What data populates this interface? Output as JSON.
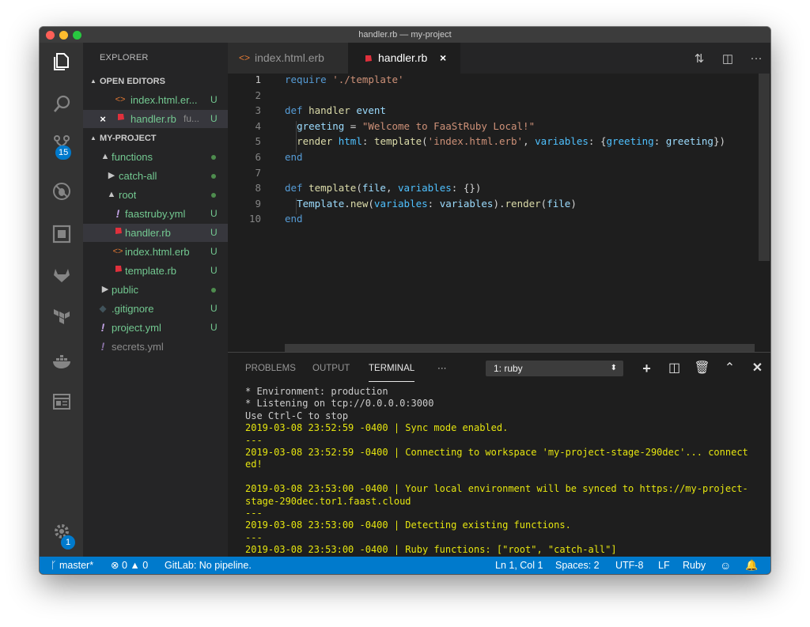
{
  "window": {
    "title": "handler.rb — my-project"
  },
  "activity": {
    "scm_badge": "15",
    "settings_badge": "1"
  },
  "sidebar": {
    "title": "EXPLORER",
    "open_editors_label": "OPEN EDITORS",
    "open_editors": [
      {
        "icon": "<>",
        "name": "index.html.er...",
        "desc": "",
        "status": "U"
      },
      {
        "icon": "×",
        "name": "handler.rb",
        "desc": "fu...",
        "status": "U"
      }
    ],
    "project_label": "MY-PROJECT",
    "tree": [
      {
        "name": "functions",
        "status": ""
      },
      {
        "name": "catch-all",
        "status": ""
      },
      {
        "name": "root",
        "status": ""
      },
      {
        "name": "faastruby.yml",
        "status": "U"
      },
      {
        "name": "handler.rb",
        "status": "U"
      },
      {
        "name": "index.html.erb",
        "status": "U"
      },
      {
        "name": "template.rb",
        "status": "U"
      },
      {
        "name": "public",
        "status": ""
      },
      {
        "name": ".gitignore",
        "status": "U"
      },
      {
        "name": "project.yml",
        "status": "U"
      },
      {
        "name": "secrets.yml",
        "status": ""
      }
    ]
  },
  "tabs": [
    {
      "label": "index.html.erb"
    },
    {
      "label": "handler.rb",
      "close": "×"
    }
  ],
  "editor": {
    "line_numbers": [
      "1",
      "2",
      "3",
      "4",
      "5",
      "6",
      "7",
      "8",
      "9",
      "10"
    ],
    "lines": [
      "require './template'",
      "",
      "def handler event",
      "  greeting = \"Welcome to FaaStRuby Local!\"",
      "  render html: template('index.html.erb', variables: {greeting: greeting})",
      "end",
      "",
      "def template(file, variables: {})",
      "  Template.new(variables: variables).render(file)",
      "end"
    ]
  },
  "panel": {
    "tabs": [
      "PROBLEMS",
      "OUTPUT",
      "TERMINAL"
    ],
    "more": "···",
    "terminal_select": "1: ruby",
    "terminal_lines": [
      {
        "t": "* Environment: production",
        "c": "w"
      },
      {
        "t": "* Listening on tcp://0.0.0.0:3000",
        "c": "w"
      },
      {
        "t": "Use Ctrl-C to stop",
        "c": "w"
      },
      {
        "t": "2019-03-08 23:52:59 -0400 | Sync mode enabled.",
        "c": "y"
      },
      {
        "t": "---",
        "c": "y"
      },
      {
        "t": "2019-03-08 23:52:59 -0400 | Connecting to workspace 'my-project-stage-290dec'... connect\ned!",
        "c": "y"
      },
      {
        "t": "",
        "c": "y"
      },
      {
        "t": "2019-03-08 23:53:00 -0400 | Your local environment will be synced to https://my-project-\nstage-290dec.tor1.faast.cloud",
        "c": "y"
      },
      {
        "t": "---",
        "c": "y"
      },
      {
        "t": "2019-03-08 23:53:00 -0400 | Detecting existing functions.",
        "c": "y"
      },
      {
        "t": "---",
        "c": "y"
      },
      {
        "t": "2019-03-08 23:53:00 -0400 | Ruby functions: [\"root\", \"catch-all\"]",
        "c": "y"
      }
    ]
  },
  "status": {
    "branch": "master*",
    "errors": "0",
    "warnings": "0",
    "gitlab": "GitLab: No pipeline.",
    "position": "Ln 1, Col 1",
    "spaces": "Spaces: 2",
    "encoding": "UTF-8",
    "eol": "LF",
    "language": "Ruby"
  },
  "colors": {
    "accent": "#007acc",
    "ruby": "#e0303c",
    "untracked": "#73c991"
  }
}
